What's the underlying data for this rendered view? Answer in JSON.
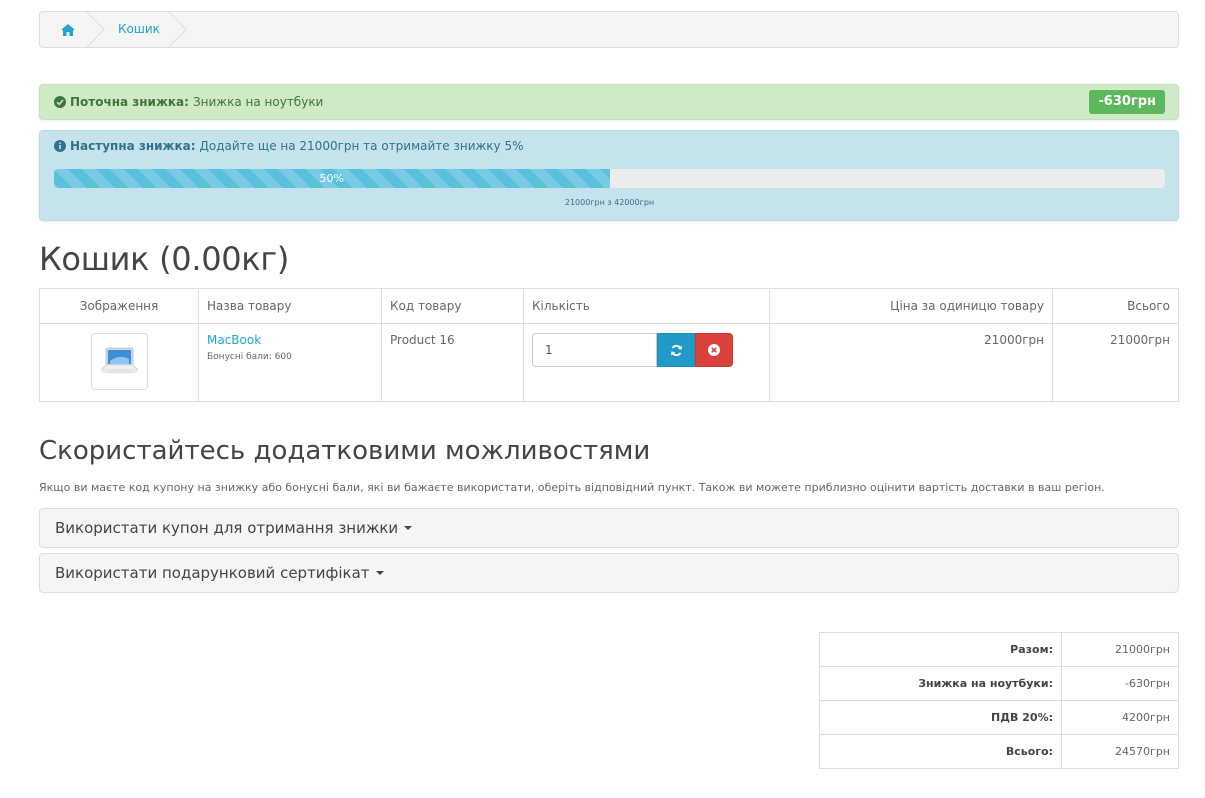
{
  "breadcrumb": {
    "home_icon": "home-icon",
    "current": "Кошик"
  },
  "current_discount": {
    "label": "Поточна знижка:",
    "text": "Знижка на ноутбуки",
    "badge": "-630грн",
    "icon": "check-circle-icon",
    "color": "#3c763d"
  },
  "next_discount": {
    "label": "Наступна знижка:",
    "text": "Додайте ще на 21000грн та отримайте знижку 5%",
    "icon": "info-circle-icon",
    "progress_percent": 50,
    "progress_label": "50%",
    "progress_caption": "21000грн з 42000грн"
  },
  "cart": {
    "heading": "Кошик  (0.00кг)",
    "columns": [
      "Зображення",
      "Назва товару",
      "Код товару",
      "Кількість",
      "Ціна за одиницю товару",
      "Всього"
    ],
    "items": [
      {
        "image": "laptop-thumbnail",
        "name": "MacBook",
        "reward": "Бонусні бали: 600",
        "model": "Product 16",
        "quantity": "1",
        "unit_price": "21000грн",
        "total": "21000грн"
      }
    ]
  },
  "options": {
    "heading": "Скористайтесь додатковими можливостями",
    "description": "Якщо ви маєте код купону на знижку або бонусні бали, які ви бажаєте використати, оберіть відповідний пункт. Також ви можете приблизно оцінити вартість доставки в ваш регіон.",
    "panels": [
      "Використати купон для отримання знижки",
      "Використати подарунковий сертифікат"
    ]
  },
  "totals": [
    {
      "label": "Разом:",
      "value": "21000грн"
    },
    {
      "label": "Знижка на ноутбуки:",
      "value": "-630грн"
    },
    {
      "label": "ПДВ 20%:",
      "value": "4200грн"
    },
    {
      "label": "Всього:",
      "value": "24570грн"
    }
  ],
  "colors": {
    "link": "#23a1d1",
    "success_badge": "#5cb85c",
    "info_bar": "#5bc0de",
    "refresh_button": "#229ac8",
    "remove_button": "#d9413c"
  }
}
